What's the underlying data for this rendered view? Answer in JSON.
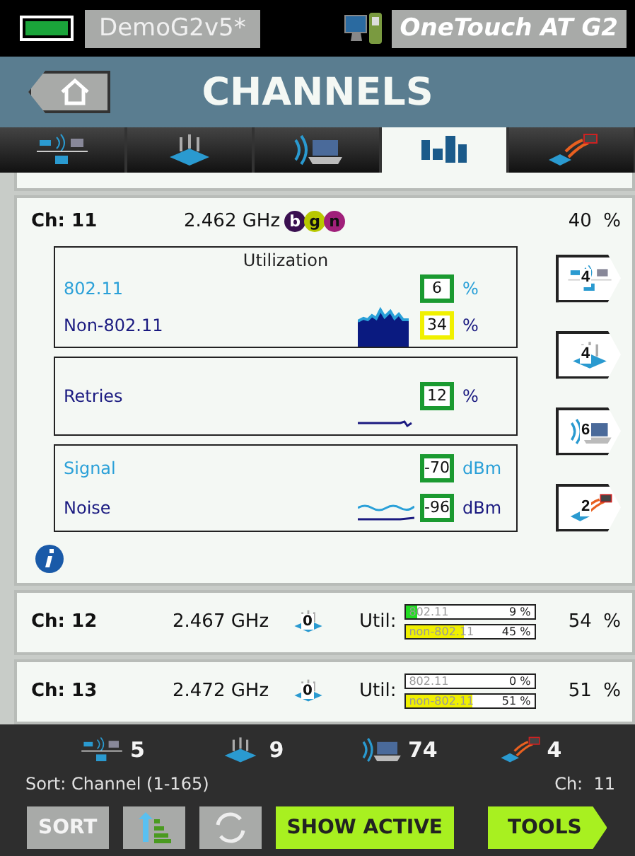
{
  "status_bar": {
    "profile": "DemoG2v5*",
    "device": "OneTouch AT G2"
  },
  "header": {
    "title": "CHANNELS"
  },
  "tabs": [
    {
      "kind": "network",
      "selected": false
    },
    {
      "kind": "access-point",
      "selected": false
    },
    {
      "kind": "client",
      "selected": false
    },
    {
      "kind": "channels",
      "selected": true
    },
    {
      "kind": "interferer",
      "selected": false
    }
  ],
  "expanded_channel": {
    "channel": "Ch: 11",
    "frequency": "2.462 GHz",
    "bands": [
      {
        "label": "b",
        "color": "#3a1050"
      },
      {
        "label": "g",
        "color": "#b8c800"
      },
      {
        "label": "n",
        "color": "#a0207a"
      }
    ],
    "total": "40  %",
    "utilization": {
      "title": "Utilization",
      "rows": [
        {
          "label": "802.11",
          "value": "6",
          "unit": "%",
          "color": "#1a9a30"
        },
        {
          "label": "Non-802.11",
          "value": "34",
          "unit": "%",
          "color": "#f0f000"
        }
      ]
    },
    "retries": {
      "label": "Retries",
      "value": "12",
      "unit": "%",
      "color": "#1a9a30"
    },
    "signal": {
      "rows": [
        {
          "label": "Signal",
          "value": "-70",
          "unit": "dBm",
          "color": "#1a9a30"
        },
        {
          "label": "Noise",
          "value": "-96",
          "unit": "dBm",
          "color": "#1a9a30"
        }
      ]
    },
    "side_buttons": [
      {
        "kind": "network",
        "count": "4"
      },
      {
        "kind": "access-point",
        "count": "4"
      },
      {
        "kind": "client",
        "count": "6"
      },
      {
        "kind": "interferer",
        "count": "2"
      }
    ]
  },
  "channels": [
    {
      "channel": "Ch: 12",
      "frequency": "2.467 GHz",
      "ap_count": "0",
      "util_label": "Util:",
      "bars": [
        {
          "label": "802.11",
          "reading": "9 %",
          "level": 0.09
        },
        {
          "label": "non-802.11",
          "reading": "45 %",
          "level": 0.45
        }
      ],
      "total": "54  %"
    },
    {
      "channel": "Ch: 13",
      "frequency": "2.472 GHz",
      "ap_count": "0",
      "util_label": "Util:",
      "bars": [
        {
          "label": "802.11",
          "reading": "0 %",
          "level": 0
        },
        {
          "label": "non-802.11",
          "reading": "51 %",
          "level": 0.51
        }
      ],
      "total": "51  %"
    }
  ],
  "summary": [
    {
      "kind": "network",
      "count": "5"
    },
    {
      "kind": "access-point",
      "count": "9"
    },
    {
      "kind": "client",
      "count": "74"
    },
    {
      "kind": "interferer",
      "count": "4"
    }
  ],
  "sort_label": "Sort: Channel (1-165)",
  "current_channel": "Ch:  11",
  "buttons": [
    {
      "kind": "gray",
      "label": "SORT"
    },
    {
      "kind": "sort-icon"
    },
    {
      "kind": "refresh-icon"
    },
    {
      "kind": "green",
      "label": "SHOW ACTIVE"
    },
    {
      "kind": "arrow",
      "label": "TOOLS"
    }
  ]
}
